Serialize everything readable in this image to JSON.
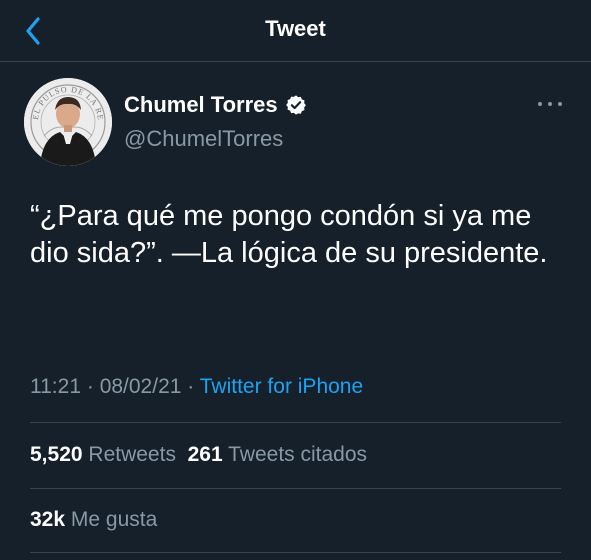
{
  "header": {
    "title": "Tweet",
    "back_icon": "chevron-left-icon"
  },
  "author": {
    "name": "Chumel Torres",
    "handle": "@ChumelTorres",
    "verified": true,
    "avatar_seal_text": "EL PULSO DE LA REPUBLICA"
  },
  "tweet": {
    "text": "“¿Para qué me pongo condón si ya me dio sida?”. —La lógica de su presidente.",
    "time": "11:21",
    "date": "08/02/21",
    "sep": "·",
    "source": "Twitter for iPhone"
  },
  "stats": {
    "retweets_count": "5,520",
    "retweets_label": "Retweets",
    "quotes_count": "261",
    "quotes_label": "Tweets citados",
    "likes_count": "32k",
    "likes_label": "Me gusta"
  },
  "colors": {
    "background": "#15202b",
    "accent": "#1da1f2",
    "secondary_text": "#8899a6",
    "divider": "#38444d"
  }
}
